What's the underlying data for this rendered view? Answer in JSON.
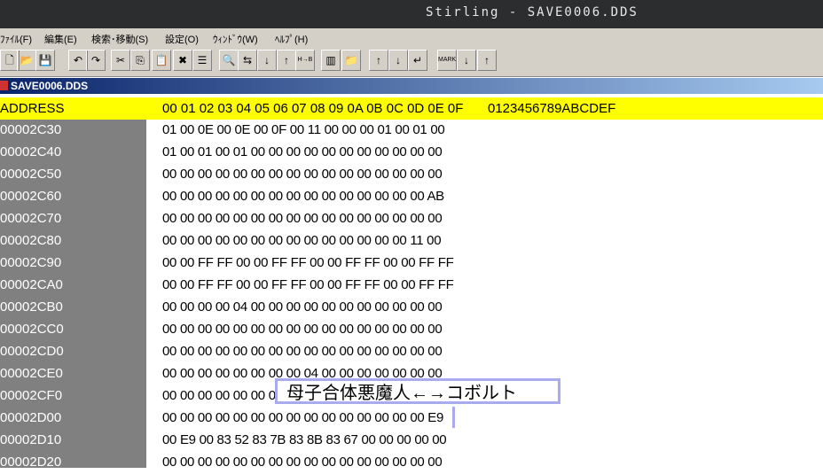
{
  "window": {
    "title": "Stirling - SAVE0006.DDS"
  },
  "menu": [
    "ﾌｧｲﾙ(F)",
    "編集(E)",
    "検索･移動(S)",
    "設定(O)",
    "ｳｨﾝﾄﾞｳ(W)",
    "ﾍﾙﾌﾟ(H)"
  ],
  "toolbar": {
    "icons": [
      "new",
      "open",
      "save",
      "undo",
      "redo",
      "cut",
      "copy",
      "paste",
      "delete",
      "list",
      "find",
      "find-replace",
      "find-next",
      "find-prev",
      "find-hex",
      "compare",
      "find-folder",
      "doc-up",
      "doc-down",
      "doc-return",
      "mark",
      "mark-next",
      "mark-prev"
    ],
    "glyphs": [
      "🗋",
      "📂",
      "💾",
      "↶",
      "↷",
      "✂",
      "⎘",
      "📋",
      "✖",
      "☰",
      "🔍",
      "⇆",
      "↓",
      "↑",
      "H→B",
      "▥",
      "📁",
      "↑",
      "↓",
      "↵",
      "MARK",
      "↓",
      "↑"
    ]
  },
  "document": {
    "title": "SAVE0006.DDS"
  },
  "header": {
    "address": "ADDRESS",
    "columns": "00 01 02 03 04 05 06 07 08 09 0A 0B 0C 0D 0E 0F",
    "ascii": "0123456789ABCDEF"
  },
  "rows": [
    {
      "addr": "00002C30",
      "hex": "01 00 0E 00 0E 00 0F 00 11 00 00 00 01 00 01 00"
    },
    {
      "addr": "00002C40",
      "hex": "01 00 01 00 01 00 00 00 00 00 00 00 00 00 00 00"
    },
    {
      "addr": "00002C50",
      "hex": "00 00 00 00 00 00 00 00 00 00 00 00 00 00 00 00"
    },
    {
      "addr": "00002C60",
      "hex": "00 00 00 00 00 00 00 00 00 00 00 00 00 00 00 AB"
    },
    {
      "addr": "00002C70",
      "hex": "00 00 00 00 00 00 00 00 00 00 00 00 00 00 00 00"
    },
    {
      "addr": "00002C80",
      "hex": "00 00 00 00 00 00 00 00 00 00 00 00 00 00 11 00"
    },
    {
      "addr": "00002C90",
      "hex": "00 00 FF FF 00 00 FF FF 00 00 FF FF 00 00 FF FF"
    },
    {
      "addr": "00002CA0",
      "hex": "00 00 FF FF 00 00 FF FF 00 00 FF FF 00 00 FF FF"
    },
    {
      "addr": "00002CB0",
      "hex": "00 00 00 00 04 00 00 00 00 00 00 00 00 00 00 00"
    },
    {
      "addr": "00002CC0",
      "hex": "00 00 00 00 00 00 00 00 00 00 00 00 00 00 00 00"
    },
    {
      "addr": "00002CD0",
      "hex": "00 00 00 00 00 00 00 00 00 00 00 00 00 00 00 00"
    },
    {
      "addr": "00002CE0",
      "hex": "00 00 00 00 00 00 00 00 04 00 00 00 00 00 00 00"
    },
    {
      "addr": "00002CF0",
      "hex": "00 00 00 00 00 00 00 00 00 00 00 00 00 00 00 00"
    },
    {
      "addr": "00002D00",
      "hex": "00 00 00 00 00 00 00 00 00 00 00 00 00 00 00 E9"
    },
    {
      "addr": "00002D10",
      "hex": "00 E9 00 83 52 83 7B 83 8B 83 67 00 00 00 00 00"
    },
    {
      "addr": "00002D20",
      "hex": "00 00 00 00 00 00 00 00 00 00 00 00 00 00 00 00"
    }
  ],
  "tooltip": {
    "text": "母子合体悪魔人←→コボルト"
  }
}
